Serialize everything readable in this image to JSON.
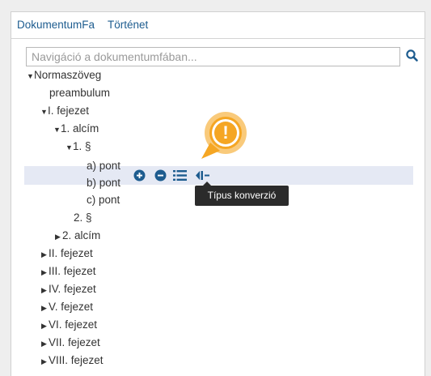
{
  "tabs": [
    {
      "label": "DokumentumFa",
      "active": true
    },
    {
      "label": "Történet",
      "active": false
    }
  ],
  "search": {
    "placeholder": "Navigáció a dokumentumfában...",
    "value": ""
  },
  "tree": [
    {
      "label": "Normaszöveg",
      "caret": "▼"
    },
    {
      "label": "preambulum",
      "caret": ""
    },
    {
      "label": "I. fejezet",
      "caret": "▼"
    },
    {
      "label": "1. alcím",
      "caret": "▼"
    },
    {
      "label": "1. §",
      "caret": "▼"
    },
    {
      "label": "a) pont",
      "caret": "",
      "selected": true
    },
    {
      "label": "b) pont",
      "caret": ""
    },
    {
      "label": "c) pont",
      "caret": ""
    },
    {
      "label": "2. §",
      "caret": ""
    },
    {
      "label": "2. alcím",
      "caret": "▶"
    },
    {
      "label": "II. fejezet",
      "caret": "▶"
    },
    {
      "label": "III. fejezet",
      "caret": "▶"
    },
    {
      "label": "IV. fejezet",
      "caret": "▶"
    },
    {
      "label": "V. fejezet",
      "caret": "▶"
    },
    {
      "label": "VI. fejezet",
      "caret": "▶"
    },
    {
      "label": "VII. fejezet",
      "caret": "▶"
    },
    {
      "label": "VIII. fejezet",
      "caret": "▶"
    }
  ],
  "row_actions": {
    "icons": [
      "add-icon",
      "remove-icon",
      "list-icon",
      "type-convert-icon"
    ],
    "tooltip": "Típus konverzió"
  },
  "warning": {
    "symbol": "!",
    "color": "#f5a623"
  },
  "colors": {
    "accent": "#1d5c8f",
    "selection": "#e5e9f4"
  }
}
